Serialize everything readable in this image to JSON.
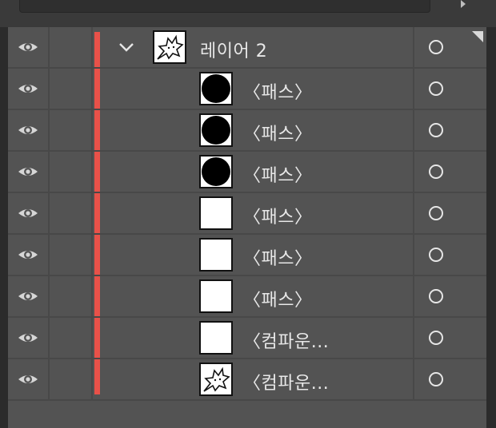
{
  "layer": {
    "name": "레이어 2",
    "color": "#e85149",
    "expanded": true,
    "thumbnail_icon": "star-doodle-icon"
  },
  "items": [
    {
      "name": "〈패스〉",
      "thumb": "black-circle"
    },
    {
      "name": "〈패스〉",
      "thumb": "black-circle"
    },
    {
      "name": "〈패스〉",
      "thumb": "black-circle"
    },
    {
      "name": "〈패스〉",
      "thumb": "blank"
    },
    {
      "name": "〈패스〉",
      "thumb": "blank"
    },
    {
      "name": "〈패스〉",
      "thumb": "blank"
    },
    {
      "name": "〈컴파운...",
      "thumb": "blank"
    },
    {
      "name": "〈컴파운...",
      "thumb": "star-doodle"
    }
  ],
  "icons": {
    "visibility": "eye-icon",
    "target": "target-ring-icon",
    "expand": "chevron-down-icon"
  }
}
